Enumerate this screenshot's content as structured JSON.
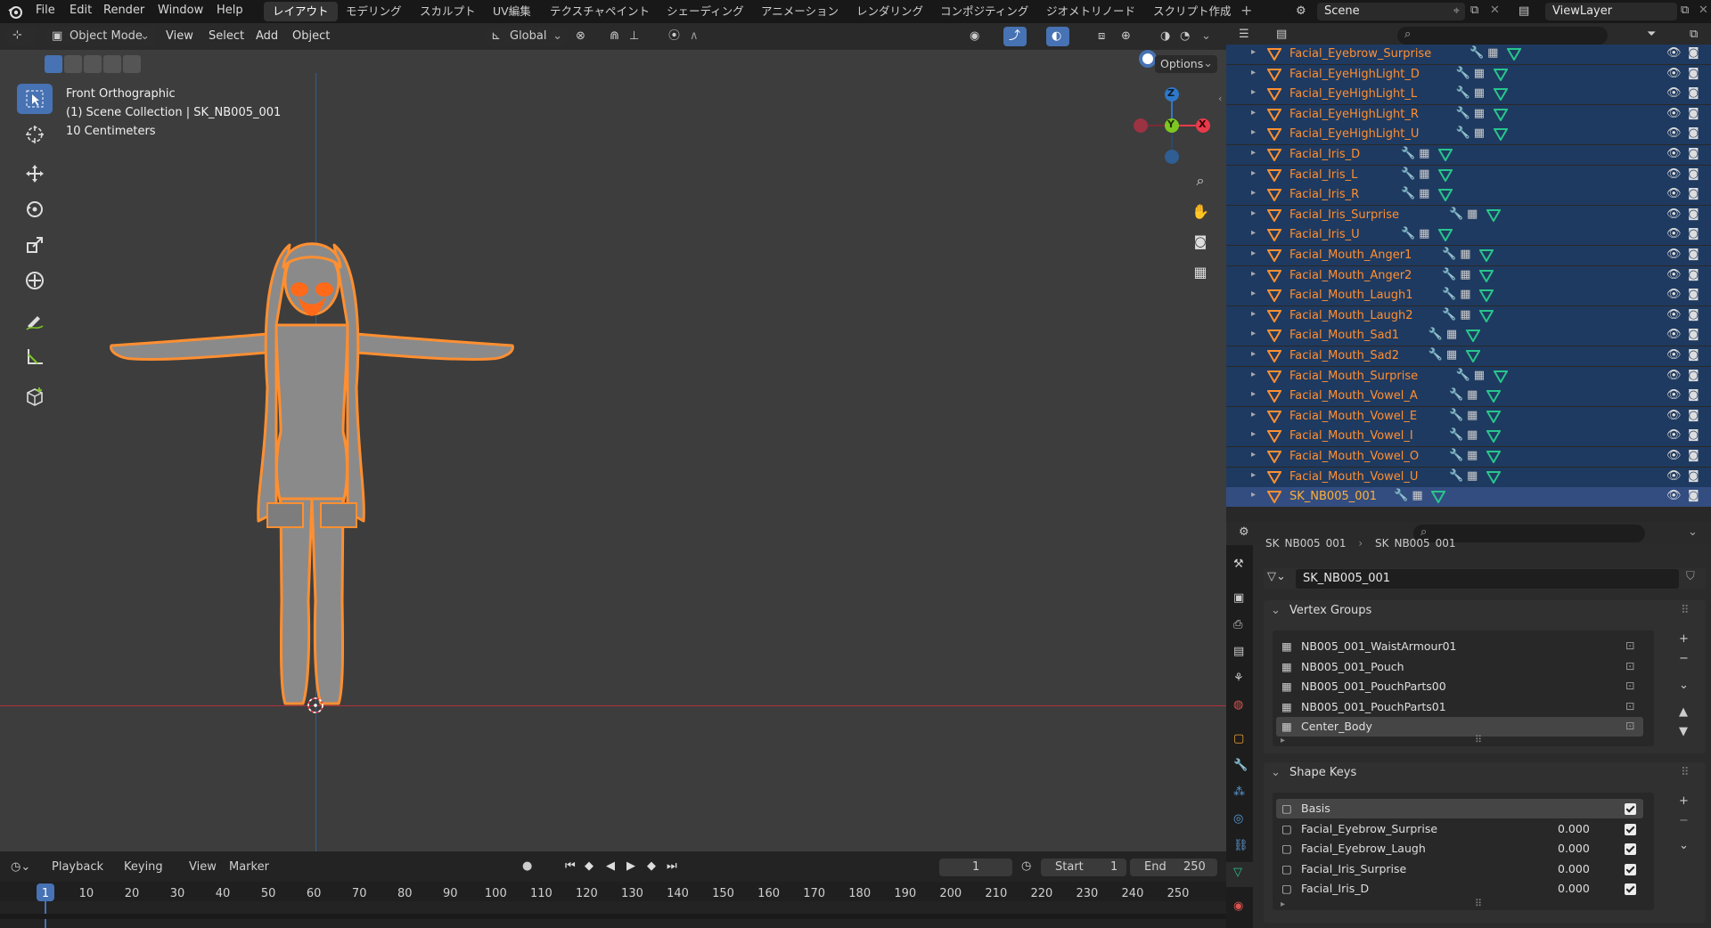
{
  "topbar": {
    "menus": [
      "File",
      "Edit",
      "Render",
      "Window",
      "Help"
    ],
    "workspaces": [
      "レイアウト",
      "モデリング",
      "スカルプト",
      "UV編集",
      "テクスチャペイント",
      "シェーディング",
      "アニメーション",
      "レンダリング",
      "コンポジティング",
      "ジオメトリノード",
      "スクリプト作成"
    ],
    "active_workspace": "レイアウト",
    "scene_label": "Scene",
    "viewlayer_label": "ViewLayer"
  },
  "viewport": {
    "mode": "Object Mode",
    "menus": [
      "View",
      "Select",
      "Add",
      "Object"
    ],
    "transform_orientation": "Global",
    "options_label": "Options",
    "overlay_title": "Front Orthographic",
    "overlay_collection": "(1) Scene Collection | SK_NB005_001",
    "overlay_scale": "10 Centimeters",
    "gizmo": {
      "z": "Z",
      "y": "Y",
      "x": "X"
    }
  },
  "outliner": {
    "items": [
      "Facial_Eyebrow_Surprise",
      "Facial_EyeHighLight_D",
      "Facial_EyeHighLight_L",
      "Facial_EyeHighLight_R",
      "Facial_EyeHighLight_U",
      "Facial_Iris_D",
      "Facial_Iris_L",
      "Facial_Iris_R",
      "Facial_Iris_Surprise",
      "Facial_Iris_U",
      "Facial_Mouth_Anger1",
      "Facial_Mouth_Anger2",
      "Facial_Mouth_Laugh1",
      "Facial_Mouth_Laugh2",
      "Facial_Mouth_Sad1",
      "Facial_Mouth_Sad2",
      "Facial_Mouth_Surprise",
      "Facial_Mouth_Vowel_A",
      "Facial_Mouth_Vowel_E",
      "Facial_Mouth_Vowel_I",
      "Facial_Mouth_Vowel_O",
      "Facial_Mouth_Vowel_U",
      "SK_NB005_001"
    ],
    "active_item": "SK_NB005_001"
  },
  "properties": {
    "breadcrumb": [
      "SK_NB005_001",
      "SK_NB005_001"
    ],
    "mesh_name": "SK_NB005_001",
    "vertex_groups_title": "Vertex Groups",
    "vertex_groups": [
      "NB005_001_WaistArmour01",
      "NB005_001_Pouch",
      "NB005_001_PouchParts00",
      "NB005_001_PouchParts01",
      "Center_Body"
    ],
    "shape_keys_title": "Shape Keys",
    "shape_keys": [
      {
        "name": "Basis",
        "value": ""
      },
      {
        "name": "Facial_Eyebrow_Surprise",
        "value": "0.000"
      },
      {
        "name": "Facial_Eyebrow_Laugh",
        "value": "0.000"
      },
      {
        "name": "Facial_Iris_Surprise",
        "value": "0.000"
      },
      {
        "name": "Facial_Iris_D",
        "value": "0.000"
      }
    ]
  },
  "timeline": {
    "menus": [
      "Playback",
      "Keying",
      "View",
      "Marker"
    ],
    "current_frame": "1",
    "start_label": "Start",
    "start_value": "1",
    "end_label": "End",
    "end_value": "250",
    "ruler": [
      "1",
      "10",
      "20",
      "30",
      "40",
      "50",
      "60",
      "70",
      "80",
      "90",
      "100",
      "110",
      "120",
      "130",
      "140",
      "150",
      "160",
      "170",
      "180",
      "190",
      "200",
      "210",
      "220",
      "230",
      "240",
      "250"
    ]
  },
  "colors": {
    "accent": "#4772b3",
    "selection_orange": "#ff8f31",
    "outliner_selected": "#1f3a60",
    "axis_x": "#e83a4b",
    "axis_y": "#7ec623",
    "axis_z": "#2e78c9"
  }
}
